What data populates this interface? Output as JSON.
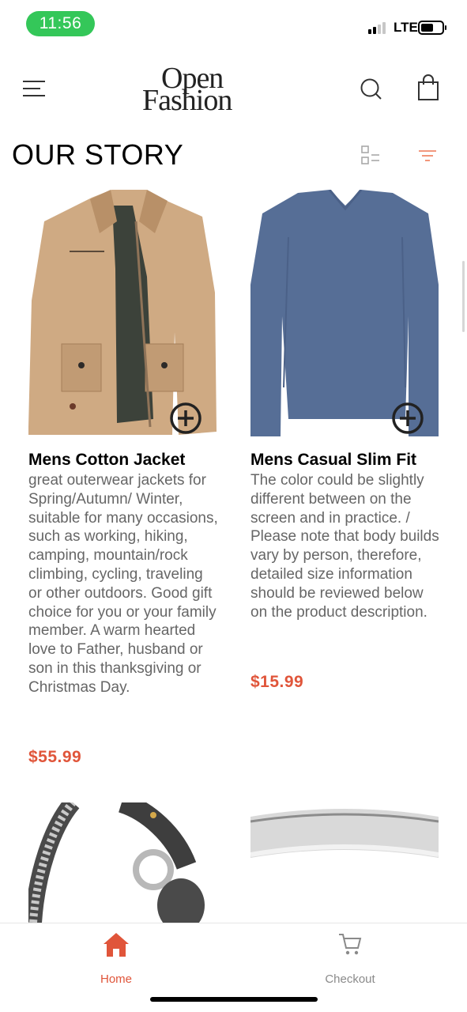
{
  "status_bar": {
    "time": "11:56",
    "network": "LTE",
    "time_pill_color": "#34c759"
  },
  "header": {
    "logo_line1": "Open",
    "logo_line2": "Fashion",
    "icons": [
      "menu-icon",
      "search-icon",
      "shopping-bag-icon"
    ]
  },
  "section": {
    "title": "OUR STORY",
    "icons": [
      "list-view-icon",
      "filter-icon"
    ],
    "filter_color": "#f08a6c"
  },
  "products": [
    {
      "name": "Mens Cotton Jacket",
      "description": "great outerwear jackets for Spring/Autumn/ Winter, suitable for many occasions, such as working, hiking, camping, mountain/rock climbing, cycling, traveling or other outdoors. Good gift choice for you or your family member. A warm hearted love to Father, husband or son in this thanksgiving or Christmas Day.",
      "price": "$55.99"
    },
    {
      "name": "Mens Casual Slim Fit",
      "description": "The color could be slightly different between on the screen and in practice. / Please note that body builds vary by person, therefore, detailed size information should be reviewed below on the product description.",
      "price": "$15.99"
    }
  ],
  "bottom_nav": {
    "items": [
      {
        "label": "Home",
        "icon": "home-icon",
        "active": true
      },
      {
        "label": "Checkout",
        "icon": "cart-icon",
        "active": false
      }
    ],
    "active_color": "#e0553a",
    "inactive_color": "#8a8a8a"
  },
  "colors": {
    "accent": "#e0553a",
    "text_secondary": "#666666"
  }
}
